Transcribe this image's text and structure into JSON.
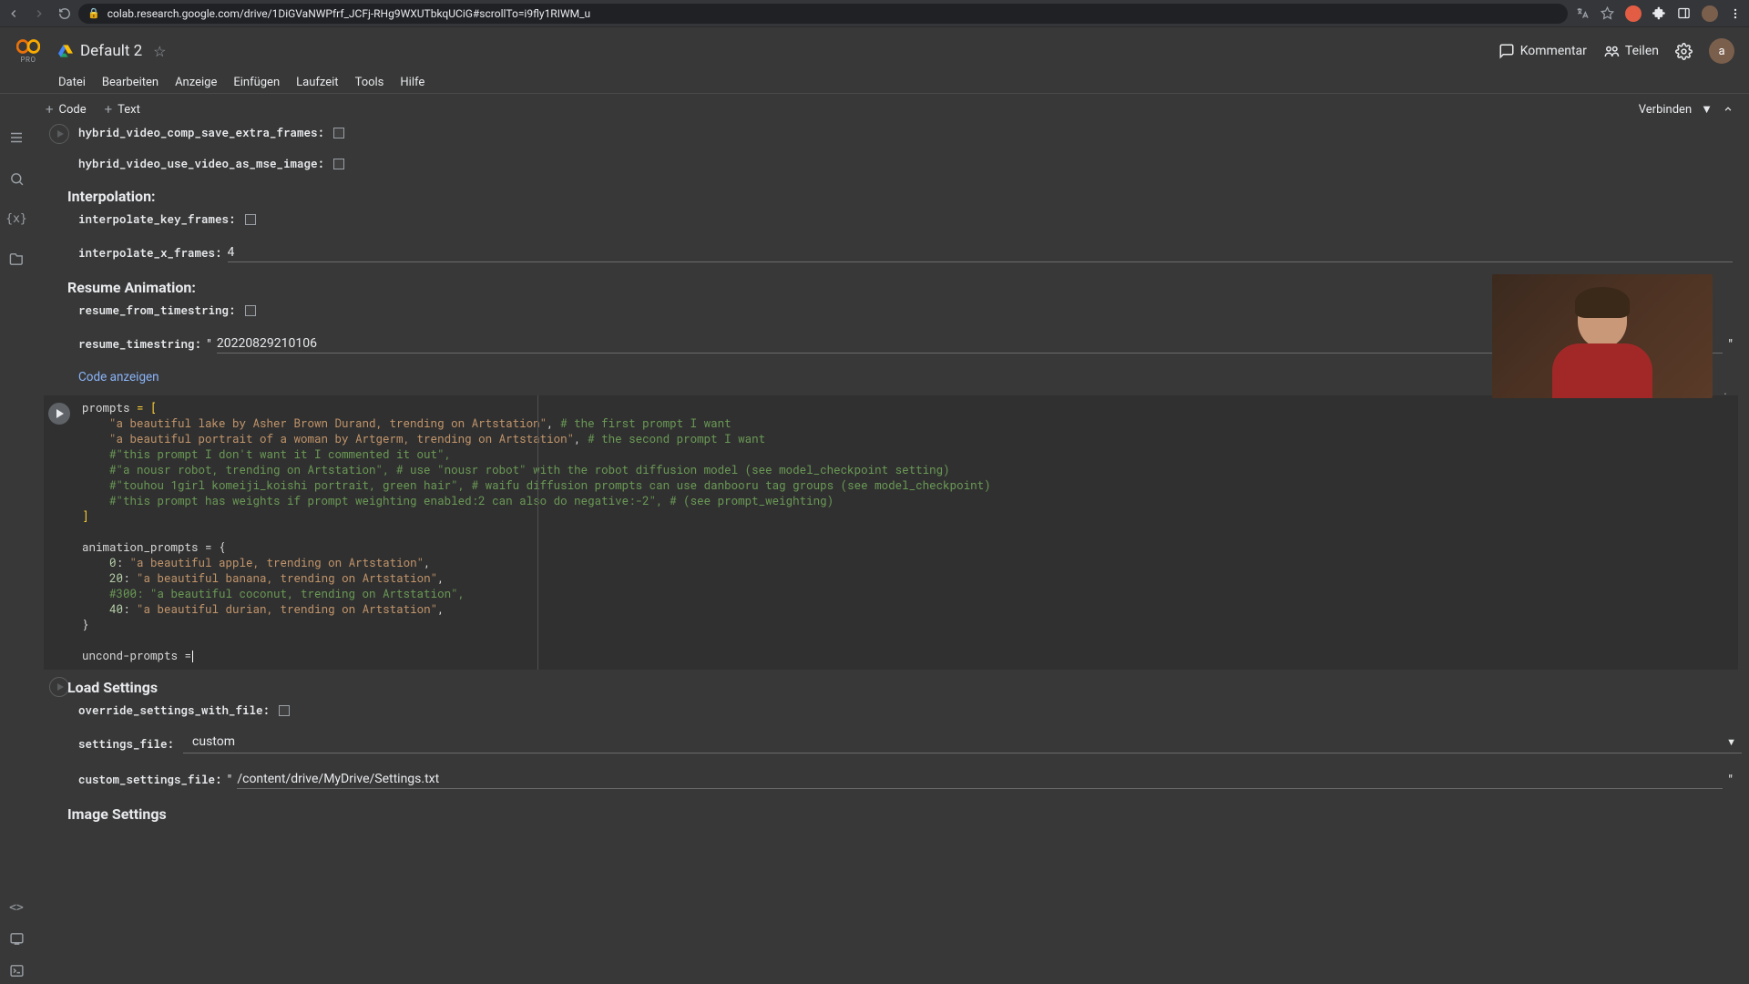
{
  "browser": {
    "url": "colab.research.google.com/drive/1DiGVaNWPfrf_JCFj-RHg9WXUTbkqUCiG#scrollTo=i9fly1RIWM_u"
  },
  "colab": {
    "notebook_title": "Default 2",
    "pro_badge": "PRO",
    "avatar_letter": "a",
    "menus": [
      "Datei",
      "Bearbeiten",
      "Anzeige",
      "Einfügen",
      "Laufzeit",
      "Tools",
      "Hilfe"
    ],
    "toolbar": {
      "code": "Code",
      "text": "Text",
      "connect": "Verbinden"
    },
    "header_right": {
      "comment": "Kommentar",
      "share": "Teilen"
    }
  },
  "form": {
    "hybrid_save": "hybrid_video_comp_save_extra_frames:",
    "hybrid_mse": "hybrid_video_use_video_as_mse_image:",
    "interp_heading": "Interpolation:",
    "interp_key": "interpolate_key_frames:",
    "interp_x": "interpolate_x_frames:",
    "interp_x_val": "4",
    "resume_heading": "Resume Animation:",
    "resume_from": "resume_from_timestring:",
    "resume_ts": "resume_timestring:",
    "resume_ts_val": "20220829210106",
    "show_code": "Code anzeigen"
  },
  "code": {
    "l1a": "prompts ",
    "l1b": "= [",
    "l2a": "    \"a beautiful lake by Asher Brown Durand, trending on Artstation\"",
    "l2b": ", ",
    "l2c": "# the first prompt I want",
    "l3a": "    \"a beautiful portrait of a woman by Artgerm, trending on Artstation\"",
    "l3b": ", ",
    "l3c": "# the second prompt I want",
    "l4": "    #\"this prompt I don't want it I commented it out\",",
    "l5": "    #\"a nousr robot, trending on Artstation\", # use \"nousr robot\" with the robot diffusion model (see model_checkpoint setting)",
    "l6": "    #\"touhou 1girl komeiji_koishi portrait, green hair\", # waifu diffusion prompts can use danbooru tag groups (see model_checkpoint)",
    "l7": "    #\"this prompt has weights if prompt weighting enabled:2 can also do negative:-2\", # (see prompt_weighting)",
    "l8": "]",
    "l10": "animation_prompts = {",
    "l11a": "    0",
    "l11b": ": ",
    "l11c": "\"a beautiful apple, trending on Artstation\"",
    "l11d": ",",
    "l12a": "    20",
    "l12b": ": ",
    "l12c": "\"a beautiful banana, trending on Artstation\"",
    "l12d": ",",
    "l13": "    #300: \"a beautiful coconut, trending on Artstation\",",
    "l14a": "    40",
    "l14b": ": ",
    "l14c": "\"a beautiful durian, trending on Artstation\"",
    "l14d": ",",
    "l15": "}",
    "l17": "uncond-prompts ="
  },
  "load": {
    "heading": "Load Settings",
    "override": "override_settings_with_file:",
    "settings_file": "settings_file:",
    "settings_file_val": "custom",
    "custom_file": "custom_settings_file:",
    "custom_file_val": "/content/drive/MyDrive/Settings.txt",
    "image_heading": "Image Settings"
  }
}
